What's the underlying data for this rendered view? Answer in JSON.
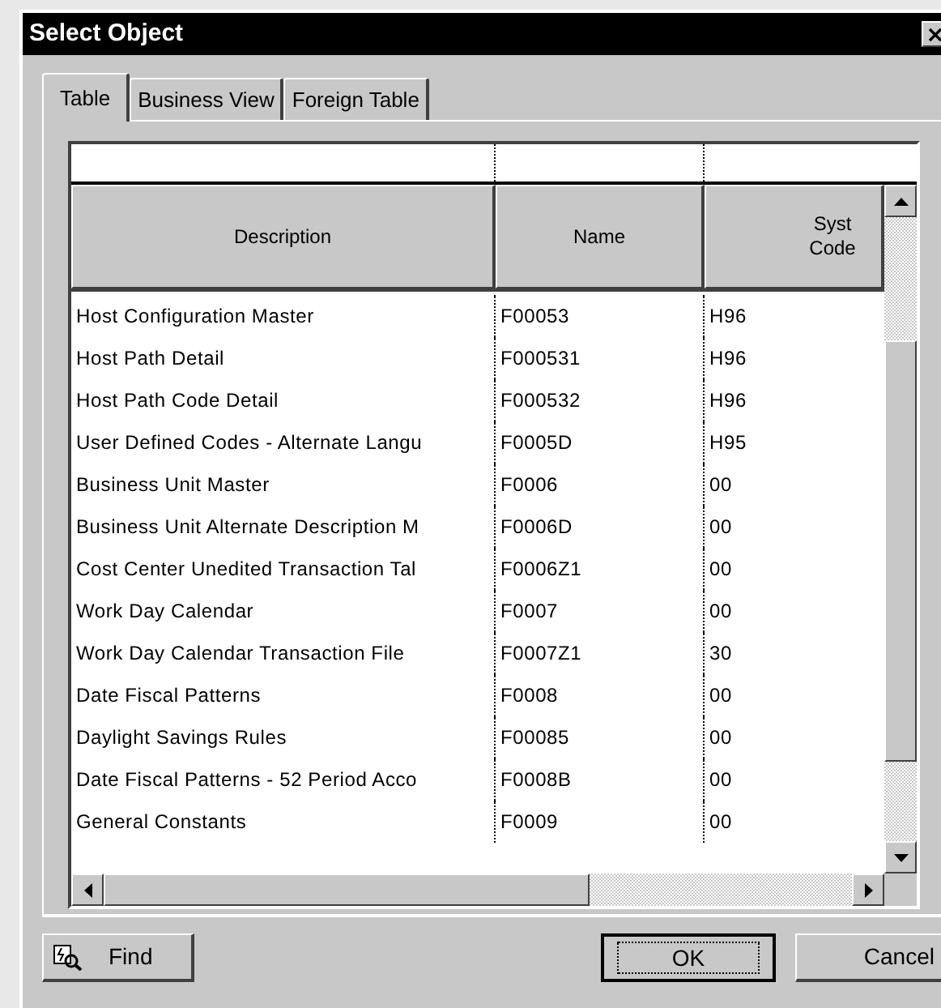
{
  "window": {
    "title": "Select Object"
  },
  "tabs": [
    {
      "label": "Table",
      "selected": true
    },
    {
      "label": "Business View",
      "selected": false
    },
    {
      "label": "Foreign Table",
      "selected": false
    }
  ],
  "table": {
    "columns": [
      "Description",
      "Name",
      "Syst Code"
    ],
    "rows": [
      [
        "Host Configuration Master",
        "F00053",
        "H96"
      ],
      [
        "Host Path Detail",
        "F000531",
        "H96"
      ],
      [
        "Host Path Code Detail",
        "F000532",
        "H96"
      ],
      [
        "User Defined Codes - Alternate Langu",
        "F0005D",
        "H95"
      ],
      [
        "Business Unit Master",
        "F0006",
        "00"
      ],
      [
        "Business Unit Alternate Description M",
        "F0006D",
        "00"
      ],
      [
        "Cost Center Unedited Transaction Tal",
        "F0006Z1",
        "00"
      ],
      [
        "Work Day Calendar",
        "F0007",
        "00"
      ],
      [
        "Work Day Calendar Transaction File",
        "F0007Z1",
        "30"
      ],
      [
        "Date Fiscal Patterns",
        "F0008",
        "00"
      ],
      [
        "Daylight Savings Rules",
        "F00085",
        "00"
      ],
      [
        "Date Fiscal Patterns - 52 Period Acco",
        "F0008B",
        "00"
      ],
      [
        "General Constants",
        "F0009",
        "00"
      ]
    ]
  },
  "buttons": [
    {
      "label": "Find",
      "kind": "icon"
    },
    {
      "label": "OK",
      "kind": "default"
    },
    {
      "label": "Cancel",
      "kind": "plain"
    }
  ]
}
